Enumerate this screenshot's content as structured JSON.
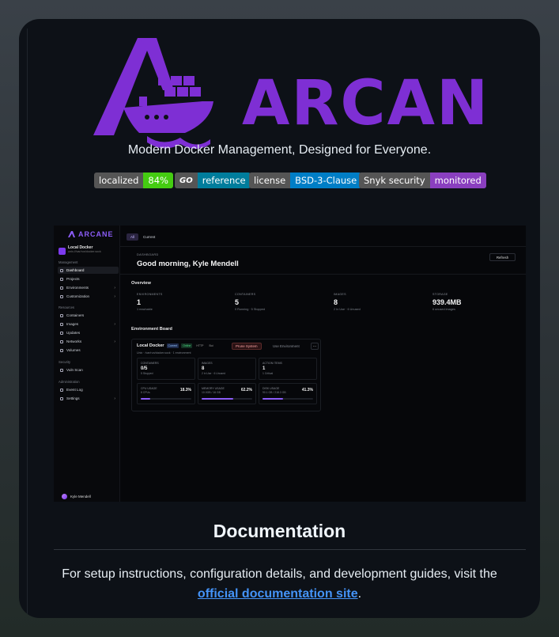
{
  "header": {
    "logo_text": "ARCANE",
    "tagline": "Modern Docker Management, Designed for Everyone."
  },
  "badges": [
    {
      "label": "localized",
      "value": "84%",
      "color": "#4c1"
    },
    {
      "label": "GO",
      "value": "reference",
      "color": "#007d9c"
    },
    {
      "label": "license",
      "value": "BSD-3-Clause",
      "color": "#007ec6"
    },
    {
      "label": "Snyk security",
      "value": "monitored",
      "color": "#8a3fbf"
    }
  ],
  "app_screenshot": {
    "logo": "ARCANE",
    "environment": {
      "name": "Local Docker",
      "socket": "unix:///var/run/docker.sock"
    },
    "sections": {
      "management": "Management",
      "resources": "Resources",
      "security": "Security",
      "administration": "Administration"
    },
    "nav": [
      "Dashboard",
      "Projects",
      "Environments",
      "Customization",
      "Containers",
      "Images",
      "Updates",
      "Networks",
      "Volumes",
      "Vuln Scan",
      "Event Log",
      "Settings"
    ],
    "user": "Kyle Mendell",
    "topbar": {
      "pill": "All",
      "crumb": "Current"
    },
    "dashboard_label": "DASHBOARD",
    "greeting": "Good morning, Kyle Mendell",
    "refresh": "Refresh",
    "overview": "Overview",
    "stats": [
      {
        "label": "ENVIRONMENTS",
        "value": "1",
        "sub": "1 reachable"
      },
      {
        "label": "CONTAINERS",
        "value": "5",
        "sub": "0 Running · 5 Stopped"
      },
      {
        "label": "IMAGES",
        "value": "8",
        "sub": "2 In Use · 6 Unused"
      },
      {
        "label": "STORAGE",
        "value": "939.4MB",
        "sub": "6 unused images"
      }
    ],
    "env_board": "Environment Board",
    "env_card": {
      "name": "Local Docker",
      "tags": [
        "Current",
        "Online",
        "HTTP",
        "Bui"
      ],
      "meta": "Unix · /var/run/docker.sock · 1 environment",
      "prune": "Prune System",
      "use": "Use Environment",
      "more": "···",
      "boxes": [
        {
          "label": "CONTAINERS",
          "value": "0/5",
          "sub": "5 Stopped"
        },
        {
          "label": "IMAGES",
          "value": "8",
          "sub": "2 in Use · 6 Unused"
        },
        {
          "label": "ACTION ITEMS",
          "value": "1",
          "sub": "1 Critical"
        }
      ],
      "usage": [
        {
          "label": "CPU USAGE",
          "pct": "18.3%",
          "sub": "8 CPUs",
          "fill": 0.183
        },
        {
          "label": "MEMORY USAGE",
          "pct": "62.2%",
          "sub": "10.0GB / 16 GB",
          "fill": 0.622
        },
        {
          "label": "DISK USAGE",
          "pct": "41.3%",
          "sub": "90.1 GB / 218.3 GB",
          "fill": 0.413
        }
      ]
    }
  },
  "documentation": {
    "title": "Documentation",
    "text": "For setup instructions, configuration details, and development guides, visit the",
    "link": "official documentation site",
    "end": "."
  }
}
